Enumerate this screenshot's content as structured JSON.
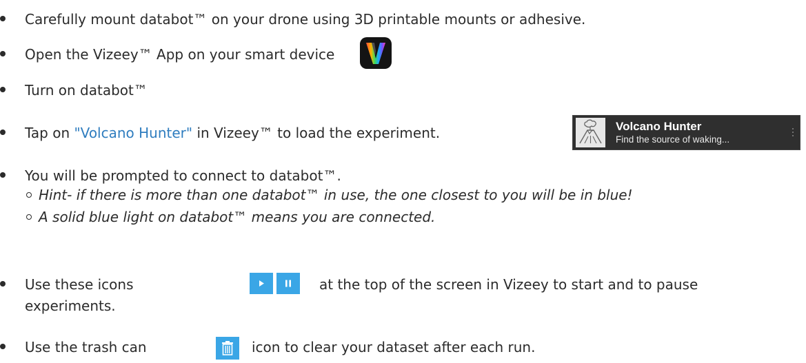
{
  "bullets": {
    "mount": "Carefully mount databot™ on your drone using 3D printable mounts or adhesive.",
    "open_app": "Open the Vizeey™ App on your smart device",
    "turn_on": "Turn on databot™",
    "tap_prefix": "Tap on ",
    "tap_link": "\"Volcano Hunter\"",
    "tap_suffix": " in Vizeey™ to load the experiment.",
    "prompted": "You will be prompted to connect to databot™.",
    "hint": "Hint- if there is more than one databot™ in use, the one closest to you will be in blue!",
    "solid_blue": "A solid blue light on databot™ means you are connected.",
    "icons_prefix": "Use these icons",
    "icons_suffix": "at the top of the screen in Vizeey to start and to pause",
    "icons_line2": "experiments.",
    "trash_prefix": "Use the trash can",
    "trash_suffix": "icon to clear your dataset after each run."
  },
  "experiment_card": {
    "title": "Volcano Hunter",
    "subtitle": "Find the source of waking..."
  },
  "icons": {
    "app": "vizeey-app-icon",
    "experiment": "volcano-icon",
    "play": "play-icon",
    "pause": "pause-icon",
    "trash": "trash-icon",
    "menu": "more-vertical-icon"
  },
  "colors": {
    "link": "#2f7dbf",
    "button_blue": "#3aa6e6",
    "card_bg": "#2f2f2f",
    "text": "#2b2b2b"
  }
}
